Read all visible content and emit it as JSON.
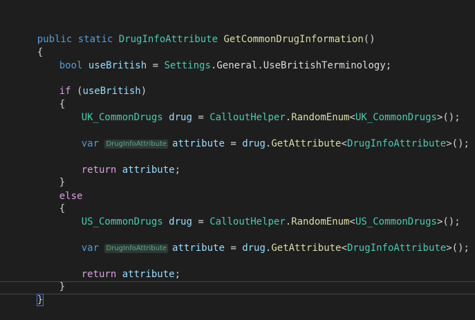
{
  "code": {
    "l1": {
      "kw1": "public",
      "kw2": "static",
      "type": "DrugInfoAttribute",
      "method": "GetCommonDrugInformation",
      "tail": "()"
    },
    "l2": {
      "brace": "{"
    },
    "l3": {
      "kw": "bool",
      "var": "useBritish",
      "op": " = ",
      "type": "Settings",
      "rest": ".General.UseBritishTerminology;"
    },
    "l5": {
      "kw": "if",
      "open": " (",
      "var": "useBritish",
      "close": ")"
    },
    "l6": {
      "brace": "{"
    },
    "l7": {
      "type": "UK_CommonDrugs",
      "var": "drug",
      "op": " = ",
      "helper": "CalloutHelper",
      "dot": ".",
      "method": "RandomEnum",
      "lt": "<",
      "generic": "UK_CommonDrugs",
      "tail": ">();"
    },
    "l9": {
      "kw": "var",
      "hint": "DrugInfoAttribute",
      "var": "attribute",
      "op": " = ",
      "var2": "drug",
      "dot": ".",
      "method": "GetAttribute",
      "lt": "<",
      "generic": "DrugInfoAttribute",
      "tail": ">();"
    },
    "l11": {
      "kw": "return",
      "var": "attribute",
      "semi": ";"
    },
    "l12": {
      "brace": "}"
    },
    "l13": {
      "kw": "else"
    },
    "l14": {
      "brace": "{"
    },
    "l15": {
      "type": "US_CommonDrugs",
      "var": "drug",
      "op": " = ",
      "helper": "CalloutHelper",
      "dot": ".",
      "method": "RandomEnum",
      "lt": "<",
      "generic": "US_CommonDrugs",
      "tail": ">();"
    },
    "l17": {
      "kw": "var",
      "hint": "DrugInfoAttribute",
      "var": "attribute",
      "op": " = ",
      "var2": "drug",
      "dot": ".",
      "method": "GetAttribute",
      "lt": "<",
      "generic": "DrugInfoAttribute",
      "tail": ">();"
    },
    "l19": {
      "kw": "return",
      "var": "attribute",
      "semi": ";"
    },
    "l20": {
      "brace": "}"
    },
    "l21": {
      "brace": "}"
    }
  }
}
